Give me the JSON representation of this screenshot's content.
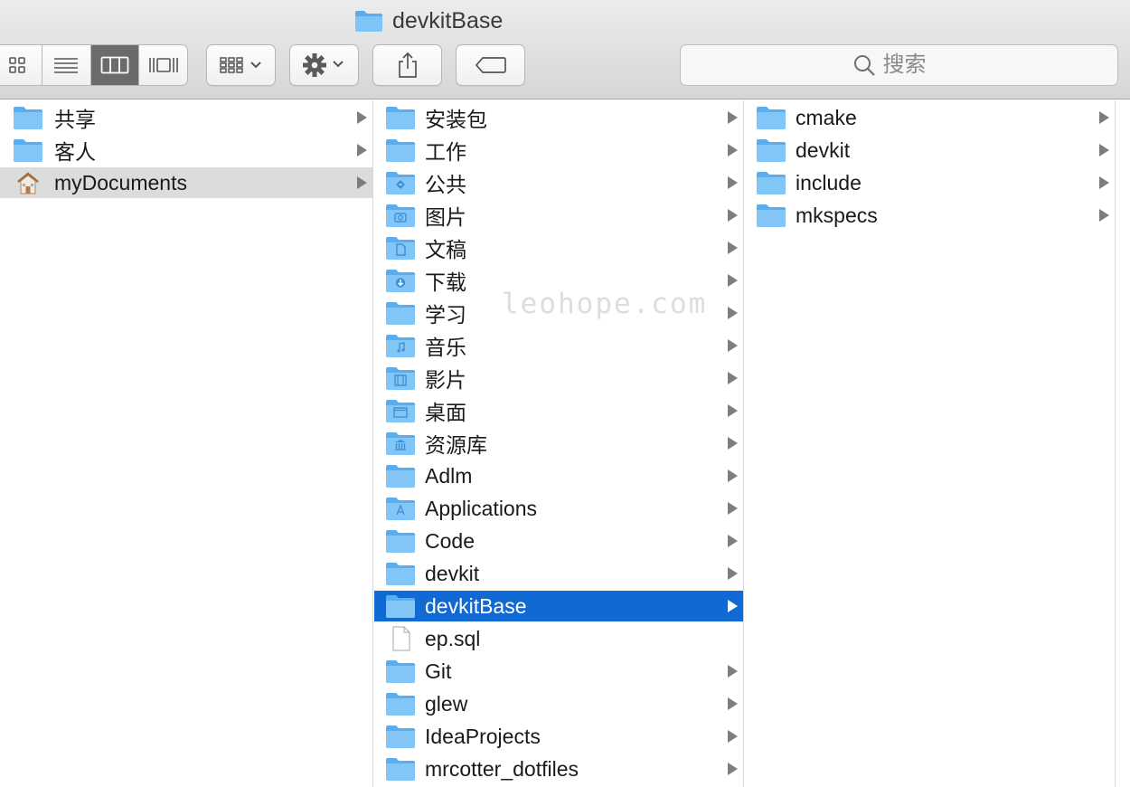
{
  "window": {
    "title": "devkitBase",
    "title_icon": "folder-icon"
  },
  "toolbar": {
    "view_modes": [
      {
        "name": "icon-view",
        "icon": "grid-icon",
        "active": false
      },
      {
        "name": "list-view",
        "icon": "list-icon",
        "active": false
      },
      {
        "name": "column-view",
        "icon": "columns-icon",
        "active": true
      },
      {
        "name": "cover-flow-view",
        "icon": "coverflow-icon",
        "active": false
      }
    ],
    "arrange_icon": "arrange-grid-icon",
    "action_icon": "gear-icon",
    "share_icon": "share-icon",
    "tag_icon": "tag-icon",
    "search": {
      "placeholder": "搜索",
      "value": ""
    }
  },
  "watermark": "leohope.com",
  "columns": [
    {
      "items": [
        {
          "label": "共享",
          "icon": "folder-icon",
          "has_children": true,
          "state": "normal"
        },
        {
          "label": "客人",
          "icon": "folder-icon",
          "has_children": true,
          "state": "normal"
        },
        {
          "label": "myDocuments",
          "icon": "home-icon",
          "has_children": true,
          "state": "dim"
        }
      ]
    },
    {
      "items": [
        {
          "label": "安装包",
          "icon": "folder-icon",
          "has_children": true,
          "state": "normal"
        },
        {
          "label": "工作",
          "icon": "folder-icon",
          "has_children": true,
          "state": "normal"
        },
        {
          "label": "公共",
          "icon": "public-folder-icon",
          "has_children": true,
          "state": "normal"
        },
        {
          "label": "图片",
          "icon": "pictures-folder-icon",
          "has_children": true,
          "state": "normal"
        },
        {
          "label": "文稿",
          "icon": "documents-folder-icon",
          "has_children": true,
          "state": "normal"
        },
        {
          "label": "下载",
          "icon": "downloads-folder-icon",
          "has_children": true,
          "state": "normal"
        },
        {
          "label": "学习",
          "icon": "folder-icon",
          "has_children": true,
          "state": "normal"
        },
        {
          "label": "音乐",
          "icon": "music-folder-icon",
          "has_children": true,
          "state": "normal"
        },
        {
          "label": "影片",
          "icon": "movies-folder-icon",
          "has_children": true,
          "state": "normal"
        },
        {
          "label": "桌面",
          "icon": "desktop-folder-icon",
          "has_children": true,
          "state": "normal"
        },
        {
          "label": "资源库",
          "icon": "library-folder-icon",
          "has_children": true,
          "state": "normal"
        },
        {
          "label": "Adlm",
          "icon": "folder-icon",
          "has_children": true,
          "state": "normal"
        },
        {
          "label": "Applications",
          "icon": "applications-folder-icon",
          "has_children": true,
          "state": "normal"
        },
        {
          "label": "Code",
          "icon": "folder-icon",
          "has_children": true,
          "state": "normal"
        },
        {
          "label": "devkit",
          "icon": "folder-icon",
          "has_children": true,
          "state": "normal"
        },
        {
          "label": "devkitBase",
          "icon": "folder-icon",
          "has_children": true,
          "state": "selected"
        },
        {
          "label": "ep.sql",
          "icon": "document-icon",
          "has_children": false,
          "state": "normal"
        },
        {
          "label": "Git",
          "icon": "folder-icon",
          "has_children": true,
          "state": "normal"
        },
        {
          "label": "glew",
          "icon": "folder-icon",
          "has_children": true,
          "state": "normal"
        },
        {
          "label": "IdeaProjects",
          "icon": "folder-icon",
          "has_children": true,
          "state": "normal"
        },
        {
          "label": "mrcotter_dotfiles",
          "icon": "folder-icon",
          "has_children": true,
          "state": "normal"
        }
      ]
    },
    {
      "items": [
        {
          "label": "cmake",
          "icon": "folder-icon",
          "has_children": true,
          "state": "normal"
        },
        {
          "label": "devkit",
          "icon": "folder-icon",
          "has_children": true,
          "state": "normal"
        },
        {
          "label": "include",
          "icon": "folder-icon",
          "has_children": true,
          "state": "normal"
        },
        {
          "label": "mkspecs",
          "icon": "folder-icon",
          "has_children": true,
          "state": "normal"
        }
      ]
    }
  ]
}
